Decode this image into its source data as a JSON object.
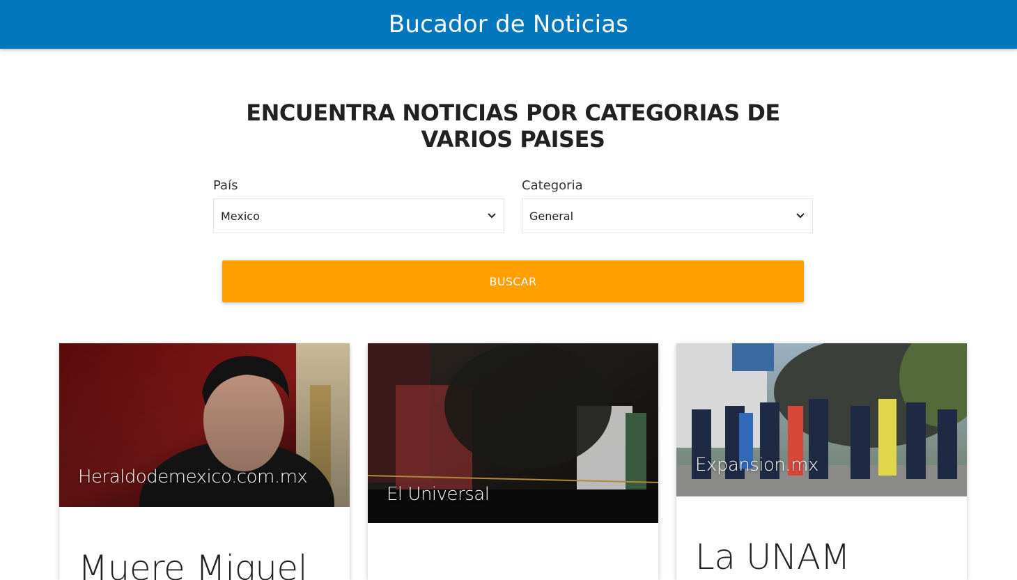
{
  "header": {
    "title": "Bucador de Noticias"
  },
  "main": {
    "heading": "ENCUENTRA NOTICIAS POR CATEGORIAS DE VARIOS PAISES",
    "country": {
      "label": "País",
      "selected": "Mexico"
    },
    "category": {
      "label": "Categoria",
      "selected": "General"
    },
    "search_button": "BUSCAR"
  },
  "cards": [
    {
      "source": "Heraldodemexico.com.mx",
      "title": "Muere Miguel"
    },
    {
      "source": "El Universal",
      "title": ""
    },
    {
      "source": "Expansion.mx",
      "title": "La UNAM"
    }
  ],
  "colors": {
    "header": "#0277bd",
    "button": "#ff9f00"
  },
  "icons": {
    "select_arrow": "chevron-down-icon"
  }
}
